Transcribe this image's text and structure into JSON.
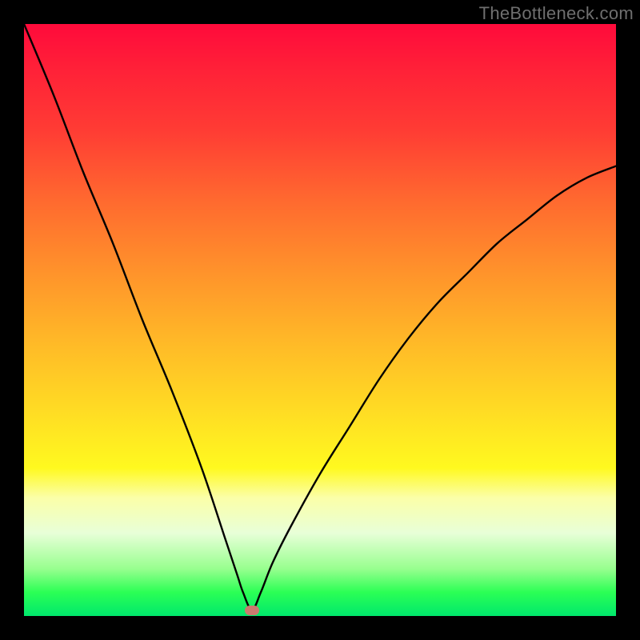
{
  "watermark": {
    "text": "TheBottleneck.com"
  },
  "chart_data": {
    "type": "line",
    "title": "",
    "xlabel": "",
    "ylabel": "",
    "xlim": [
      0,
      100
    ],
    "ylim": [
      0,
      100
    ],
    "grid": false,
    "legend": false,
    "series": [
      {
        "name": "bottleneck-curve",
        "x": [
          0,
          5,
          10,
          15,
          20,
          25,
          30,
          34,
          36,
          37,
          38.5,
          40,
          42,
          45,
          50,
          55,
          60,
          65,
          70,
          75,
          80,
          85,
          90,
          95,
          100
        ],
        "values": [
          100,
          88,
          75,
          63,
          50,
          38,
          25,
          13,
          7,
          4,
          1,
          4,
          9,
          15,
          24,
          32,
          40,
          47,
          53,
          58,
          63,
          67,
          71,
          74,
          76
        ]
      }
    ],
    "marker": {
      "x": 38.5,
      "y": 1
    },
    "background_gradient": {
      "top": "#ff0a3b",
      "mid": "#ffe123",
      "bottom": "#00e86c"
    }
  }
}
